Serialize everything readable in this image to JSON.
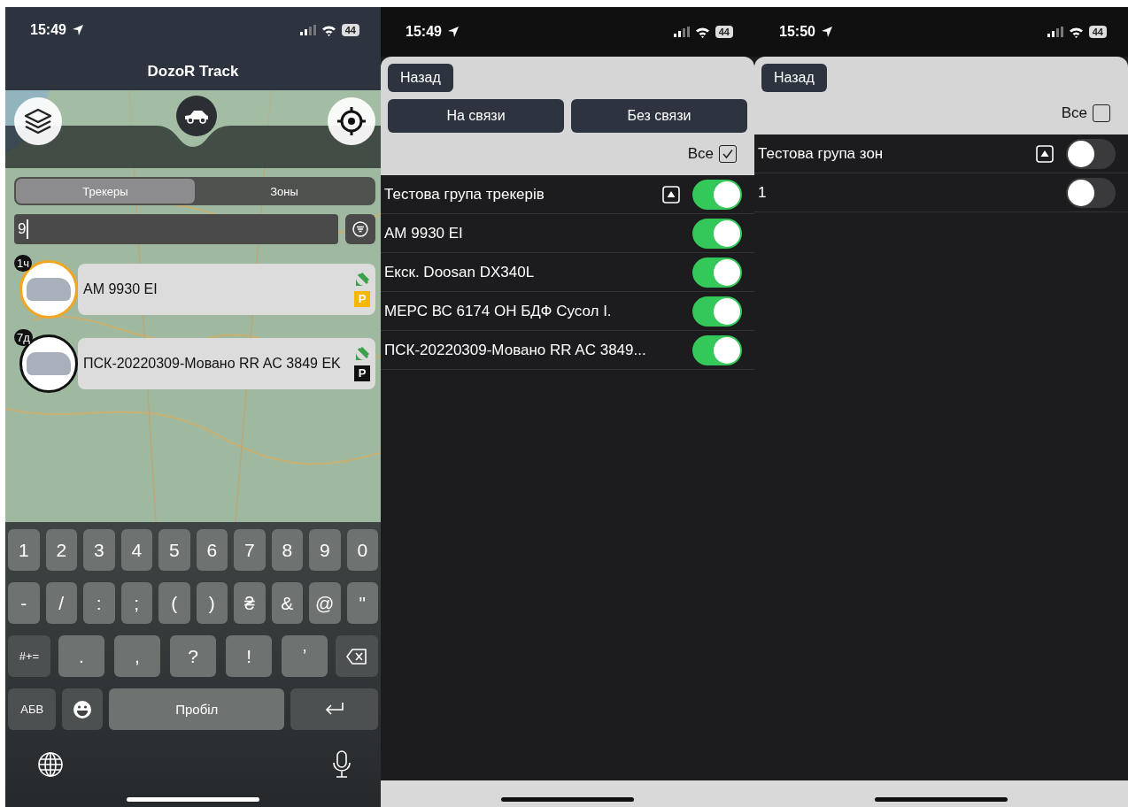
{
  "screens": [
    {
      "kind": "map",
      "status_bar": {
        "time": "15:49",
        "battery": "44"
      },
      "title": "DozoR Track",
      "segments": [
        {
          "label": "Трекеры",
          "selected": true
        },
        {
          "label": "Зоны",
          "selected": false
        }
      ],
      "search": {
        "value": "9"
      },
      "trackers": [
        {
          "badge": "1ч",
          "name": "AM 9930 EI",
          "color": "#f2a51f",
          "parking": {
            "label": "P",
            "color": "#f5b700"
          }
        },
        {
          "badge": "7д",
          "name": "ПСК-20220309-Мовано RR AC 3849 EK",
          "color": "#111111",
          "parking": {
            "label": "P",
            "color": "#111111"
          }
        }
      ],
      "keyboard": [
        [
          {
            "kind": "char",
            "label": "1"
          },
          {
            "kind": "char",
            "label": "2"
          },
          {
            "kind": "char",
            "label": "3"
          },
          {
            "kind": "char",
            "label": "4"
          },
          {
            "kind": "char",
            "label": "5"
          },
          {
            "kind": "char",
            "label": "6"
          },
          {
            "kind": "char",
            "label": "7"
          },
          {
            "kind": "char",
            "label": "8"
          },
          {
            "kind": "char",
            "label": "9"
          },
          {
            "kind": "char",
            "label": "0"
          }
        ],
        [
          {
            "kind": "char",
            "label": "-"
          },
          {
            "kind": "char",
            "label": "/"
          },
          {
            "kind": "char",
            "label": ":"
          },
          {
            "kind": "char",
            "label": ";"
          },
          {
            "kind": "char",
            "label": "("
          },
          {
            "kind": "char",
            "label": ")"
          },
          {
            "kind": "char",
            "label": "₴"
          },
          {
            "kind": "char",
            "label": "&"
          },
          {
            "kind": "char",
            "label": "@"
          },
          {
            "kind": "char",
            "label": "\""
          }
        ],
        [
          {
            "kind": "mod",
            "label": "#+="
          },
          {
            "kind": "wide",
            "label": "."
          },
          {
            "kind": "wide",
            "label": ","
          },
          {
            "kind": "wide",
            "label": "?"
          },
          {
            "kind": "wide",
            "label": "!"
          },
          {
            "kind": "wide",
            "label": "ʼ"
          },
          {
            "kind": "backspace"
          }
        ],
        [
          {
            "kind": "mod",
            "label": "АБВ"
          },
          {
            "kind": "emoji"
          },
          {
            "kind": "space",
            "label": "Пробіл"
          },
          {
            "kind": "return"
          }
        ]
      ]
    },
    {
      "kind": "list",
      "status_bar": {
        "time": "15:49",
        "battery": "44"
      },
      "back": "Назад",
      "filters": [
        "На связи",
        "Без связи"
      ],
      "all": {
        "label": "Все",
        "checked": true
      },
      "rows": [
        {
          "kind": "group",
          "name": "Тестова група трекерів",
          "on": true
        },
        {
          "kind": "item",
          "name": "AM 9930 EI",
          "on": true
        },
        {
          "kind": "item",
          "name": "Екск. Doosan DX340L",
          "on": true
        },
        {
          "kind": "item",
          "name": "МЕРС ВС 6174 ОН БДФ Сусол І.",
          "on": true
        },
        {
          "kind": "item",
          "name": "ПСК-20220309-Мовано RR AC 3849...",
          "on": true
        }
      ]
    },
    {
      "kind": "list",
      "status_bar": {
        "time": "15:50",
        "battery": "44"
      },
      "back": "Назад",
      "all": {
        "label": "Все",
        "checked": false
      },
      "rows": [
        {
          "kind": "group",
          "name": "Тестова група зон",
          "on": false
        },
        {
          "kind": "item",
          "name": "1",
          "on": false
        }
      ]
    }
  ]
}
